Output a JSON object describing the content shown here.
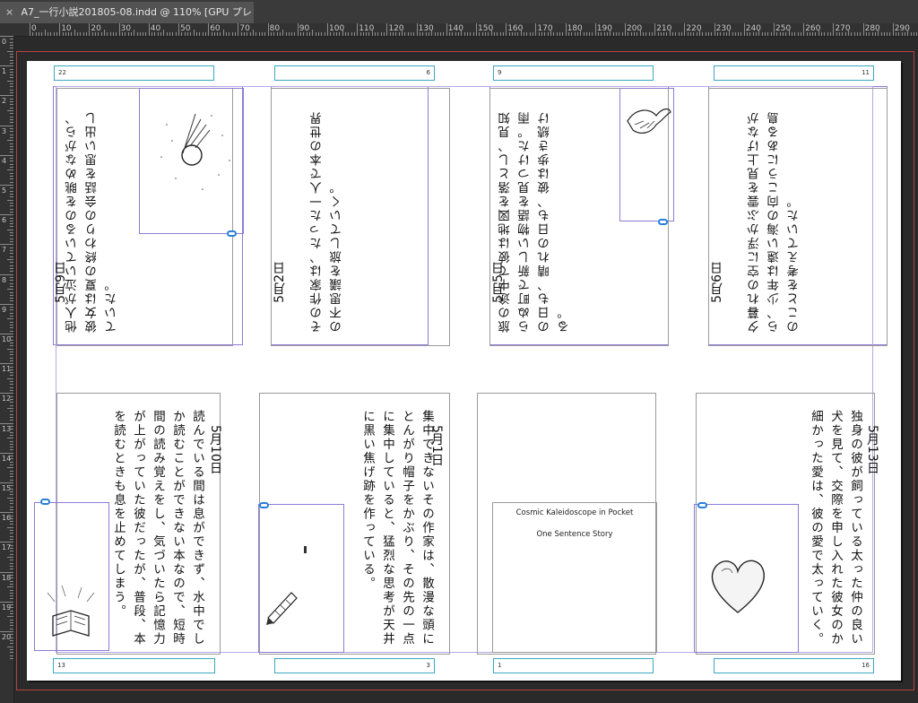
{
  "tab": {
    "close_glyph": "×",
    "title": "A7_一行小説201805-08.indd @ 110% [GPU プレビュー]"
  },
  "rulers": {
    "horizontal": [
      "0",
      "10",
      "20",
      "30",
      "40",
      "50",
      "60",
      "70",
      "80",
      "90",
      "100",
      "110",
      "120",
      "130",
      "140",
      "150",
      "160",
      "170",
      "180",
      "190",
      "200",
      "210",
      "220",
      "230",
      "240",
      "250",
      "260",
      "270",
      "280",
      "290"
    ],
    "vertical": [
      "0",
      "1",
      "2",
      "3",
      "4",
      "5",
      "6",
      "7",
      "8",
      "9",
      "10",
      "11",
      "12",
      "13",
      "14",
      "15",
      "16",
      "17",
      "18",
      "19",
      "20"
    ]
  },
  "pages_top": [
    {
      "page_label": "22",
      "date": "5月9日",
      "text": "他人が泣いているのを眺めながら、彼女は夏の終わりの会話を思い出していた。"
    },
    {
      "page_label": "6",
      "date": "5月2日",
      "text": "その作家は、たった一人で本の世界の不思議を旅していく。"
    },
    {
      "page_label": "9",
      "date": "5月5日",
      "text": "旅の途中で彼は地図を落とし、見知らぬ町で新しい物語を見つけた。雨の日も、晴れの日も、彼は歩き続ける。"
    },
    {
      "page_label": "11",
      "date": "5月6日",
      "text": "夕暮れの空に浮かぶ雲を見上げながら、少年は遠い海の向こうにある島のことを考えていた。"
    }
  ],
  "pages_bottom": [
    {
      "page_label": "13",
      "date": "5月10日",
      "text": "読んでいる間は息ができず、水中でしか読むことができない本なので、短時間の読み覚えをし、気づいたら記憶力が上がっていた彼だったが、普段、本を読むときも息を止めてしまう。"
    },
    {
      "page_label": "3",
      "date": "5月1日",
      "text": "集中できないその作家は、散漫な頭にとんがり帽子をかぶり、その先の一点に集中していると、猛烈な思考が天井に黒い焦げ跡を作っている。"
    },
    {
      "page_label": "1",
      "title_en": "Cosmic Kaleidoscope in Pocket",
      "subtitle_en": "One Sentence Story"
    },
    {
      "page_label": "16",
      "date": "5月13日",
      "text": "独身の彼が飼っている太った仲の良い犬を見て、交際を申し入れた彼女のか細かった愛は、彼の愛で太っていく。"
    }
  ],
  "icons": {
    "comet": "comet-illustration",
    "bird": "bird-illustration",
    "book": "open-book-illustration",
    "pencil": "pencil-illustration",
    "heart": "heart-illustration",
    "link": "link-icon"
  }
}
